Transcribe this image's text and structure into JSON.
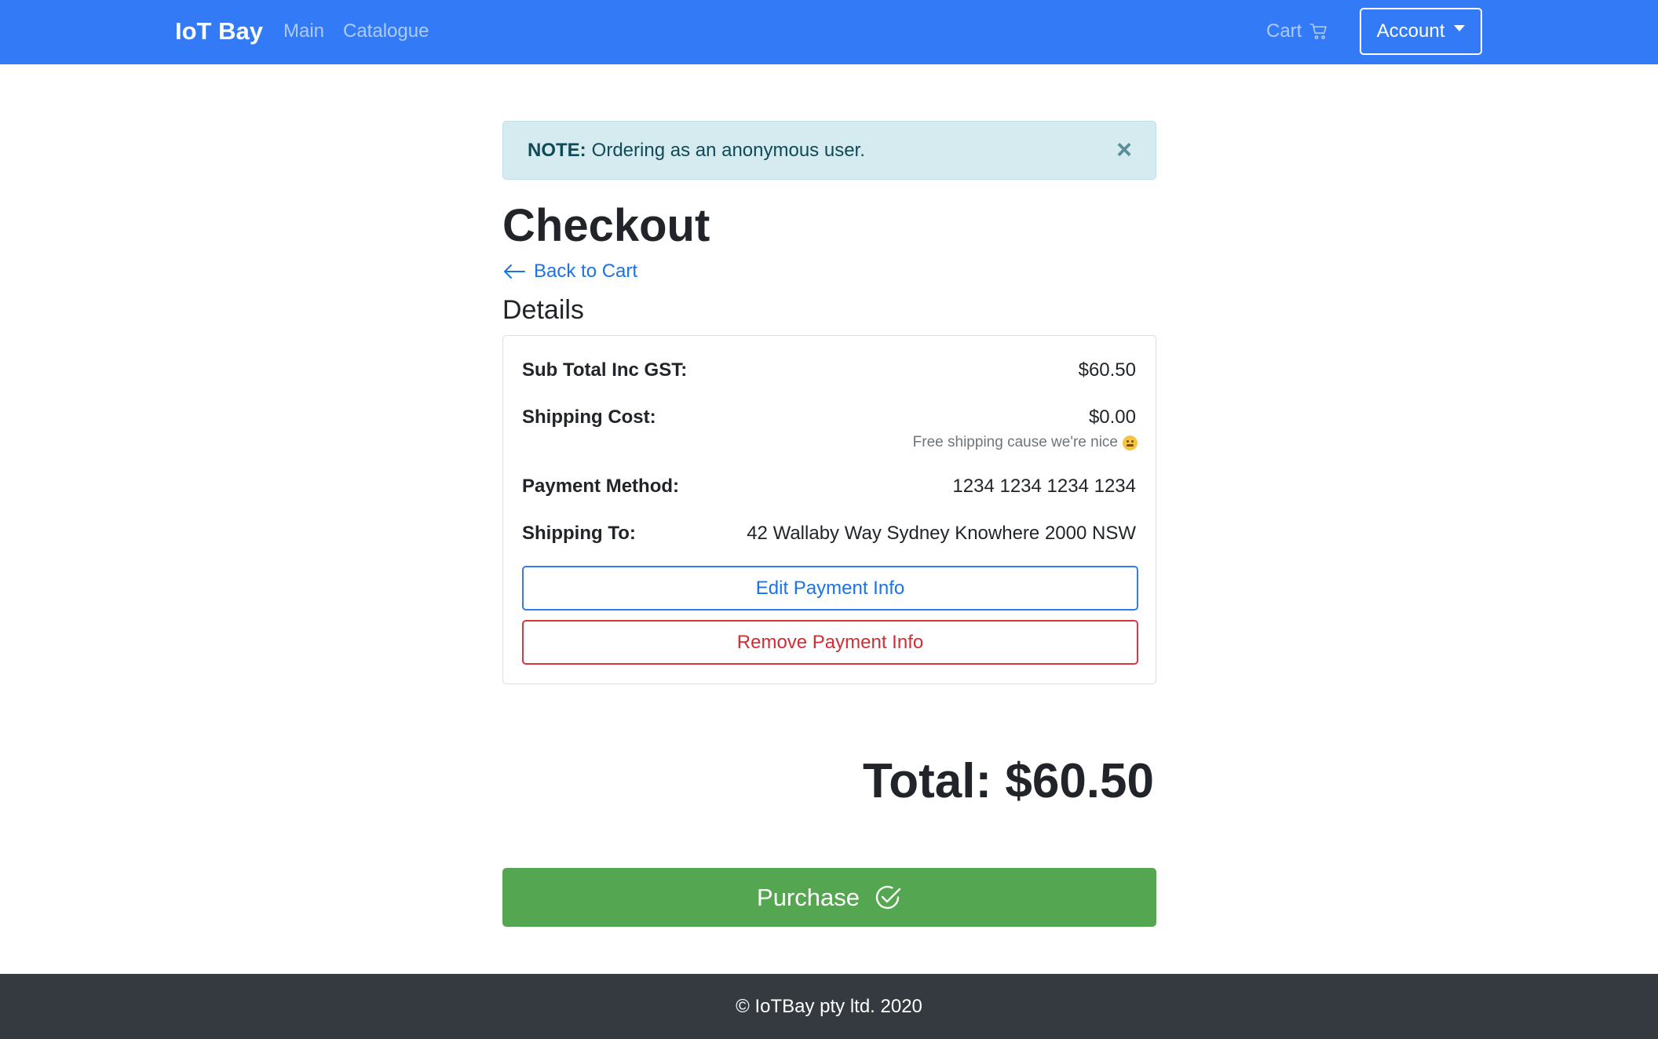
{
  "navbar": {
    "brand": "IoT Bay",
    "links": [
      "Main",
      "Catalogue"
    ],
    "cart_label": "Cart",
    "account_label": "Account",
    "background": "#337bf6"
  },
  "alert": {
    "strong": "NOTE:",
    "text": "Ordering as an anonymous user.",
    "close": "×"
  },
  "page": {
    "title": "Checkout",
    "back_link": "Back to Cart",
    "details_heading": "Details"
  },
  "details": {
    "subtotal_label": "Sub Total Inc GST:",
    "subtotal_value": "$60.50",
    "shipping_label": "Shipping Cost:",
    "shipping_value": "$0.00",
    "shipping_note": "Free shipping cause we're nice",
    "payment_label": "Payment Method:",
    "payment_value": "1234 1234 1234 1234",
    "ship_to_label": "Shipping To:",
    "ship_to_value": "42 Wallaby Way Sydney Knowhere 2000 NSW",
    "edit_button": "Edit Payment Info",
    "remove_button": "Remove Payment Info"
  },
  "total": "Total: $60.50",
  "purchase_button": "Purchase",
  "footer": "© IoTBay pty ltd. 2020",
  "icons": [
    "cart-icon",
    "chevron-down-icon",
    "close-icon",
    "arrow-left-icon",
    "smiley-icon",
    "check-circle-icon"
  ],
  "colors": {
    "primary": "#337bf6",
    "success": "#55a651",
    "danger": "#d9363e",
    "info_bg": "#d6ebf0",
    "footer_bg": "#343a40"
  }
}
